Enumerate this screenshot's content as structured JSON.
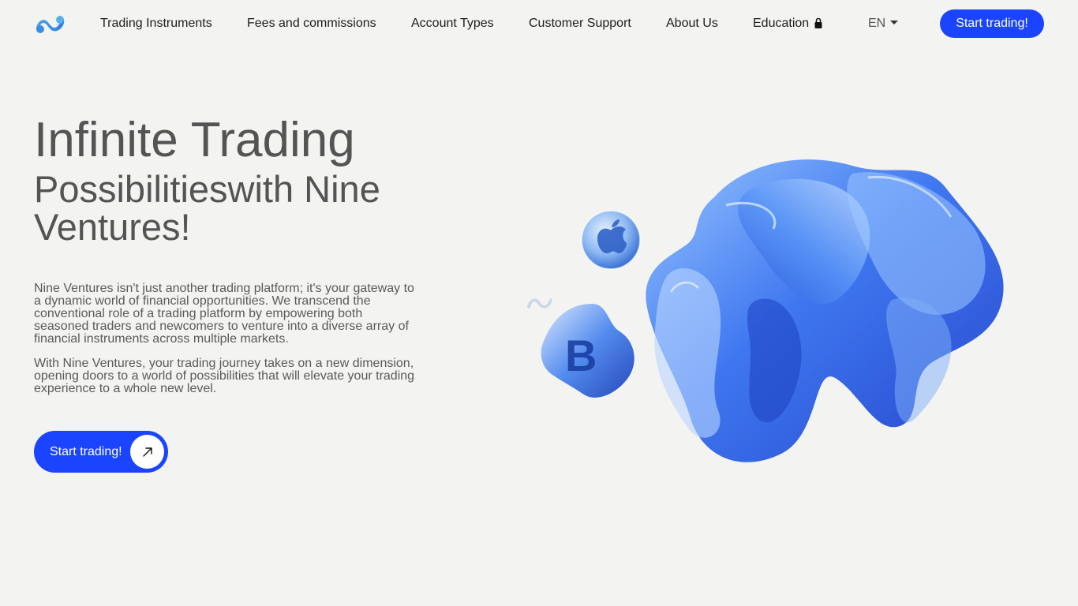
{
  "header": {
    "nav": [
      {
        "label": "Trading Instruments"
      },
      {
        "label": "Fees and commissions"
      },
      {
        "label": "Account Types"
      },
      {
        "label": "Customer Support"
      },
      {
        "label": "About Us"
      },
      {
        "label": "Education"
      }
    ],
    "language": "EN",
    "cta_label": "Start trading!"
  },
  "hero": {
    "headline_line1": "Infinite Trading",
    "headline_line2": "Possibilitieswith Nine Ventures!",
    "paragraph_1": "Nine Ventures isn't just another trading platform; it's your gateway to a dynamic world of financial opportunities. We transcend the conventional role of a trading platform by empowering both seasoned traders and newcomers to venture into a diverse array of financial instruments across multiple markets.",
    "paragraph_2": "With Nine Ventures, your trading journey takes on a new dimension, opening doors to a world of possibilities that will elevate your trading experience to a whole new level.",
    "cta_label": "Start trading!"
  },
  "icons": {
    "logo": "nine-ventures-logo",
    "lock": "lock-icon",
    "caret": "chevron-down-icon",
    "arrow": "arrow-up-right-icon"
  },
  "colors": {
    "accent": "#1a44ff",
    "background": "#f3f3f1",
    "headline": "#545454",
    "body_text": "#5a5a5a"
  }
}
